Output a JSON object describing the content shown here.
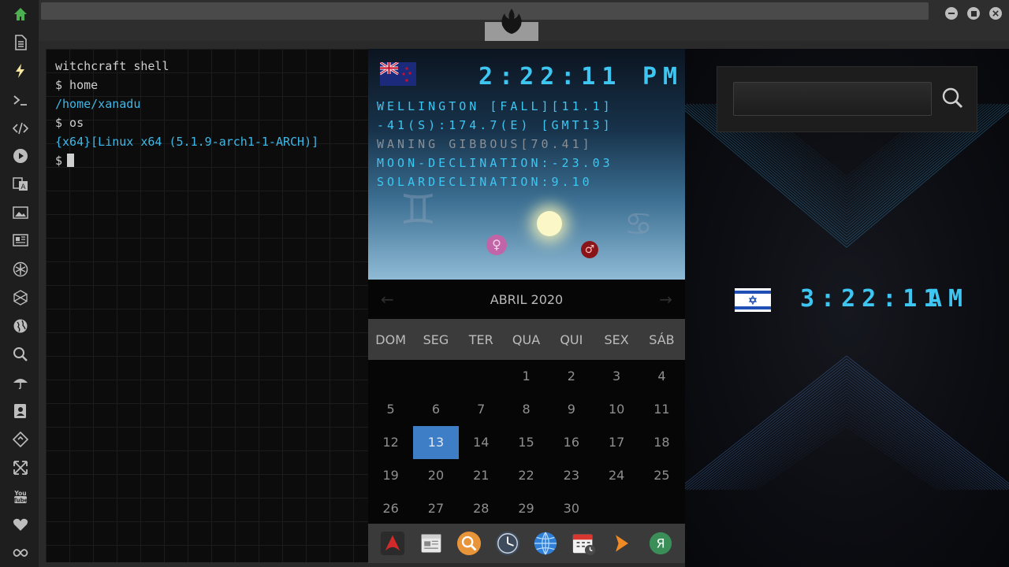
{
  "sidebar": {
    "items": [
      {
        "name": "home-icon",
        "color": "#4caf50"
      },
      {
        "name": "file-icon"
      },
      {
        "name": "bolt-icon",
        "color": "#f5e6a0"
      },
      {
        "name": "terminal-icon"
      },
      {
        "name": "code-icon"
      },
      {
        "name": "play-icon"
      },
      {
        "name": "translate-icon"
      },
      {
        "name": "image-icon"
      },
      {
        "name": "news-icon"
      },
      {
        "name": "rebel-icon"
      },
      {
        "name": "hexagon-icon"
      },
      {
        "name": "globe-icon"
      },
      {
        "name": "search-icon"
      },
      {
        "name": "umbrella-icon"
      },
      {
        "name": "contact-icon"
      },
      {
        "name": "git-icon"
      },
      {
        "name": "expand-icon"
      },
      {
        "name": "youtube-icon"
      },
      {
        "name": "heart-icon"
      },
      {
        "name": "infinity-icon"
      }
    ]
  },
  "terminal": {
    "lines": [
      {
        "text": "witchcraft shell",
        "style": "white"
      },
      {
        "text": "$ home",
        "style": "white"
      },
      {
        "text": "/home/xanadu",
        "style": "blue"
      },
      {
        "text": "$ os",
        "style": "white"
      },
      {
        "text": "{x64}[Linux x64 (5.1.9-arch1-1-ARCH)]",
        "style": "blue"
      }
    ],
    "prompt": "$"
  },
  "sky_clock": {
    "time": "2:22:11",
    "ampm": "PM",
    "lines": [
      {
        "text": "WELLINGTON [FALL][11.1]",
        "dim": false
      },
      {
        "text": "-41(S):174.7(E) [GMT13]",
        "dim": false
      },
      {
        "text": "WANING GIBBOUS[70.41]",
        "dim": true
      },
      {
        "text": "MOON-DECLINATION:-23.03",
        "dim": false
      },
      {
        "text": "SOLARDECLINATION:9.10",
        "dim": false
      }
    ],
    "venus_symbol": "♀",
    "mars_symbol": "♂",
    "gemini_symbol": "♊",
    "cancer_symbol": "♋"
  },
  "calendar": {
    "month_label": "ABRIL 2020",
    "prev": "←",
    "next": "→",
    "weekdays": [
      "DOM",
      "SEG",
      "TER",
      "QUA",
      "QUI",
      "SEX",
      "SÁB"
    ],
    "days": [
      "",
      "",
      "",
      "1",
      "2",
      "3",
      "4",
      "5",
      "6",
      "7",
      "8",
      "9",
      "10",
      "11",
      "12",
      "13",
      "14",
      "15",
      "16",
      "17",
      "18",
      "19",
      "20",
      "21",
      "22",
      "23",
      "24",
      "25",
      "26",
      "27",
      "28",
      "29",
      "30"
    ],
    "selected": "13",
    "selected_color": "#3d7ec6"
  },
  "dock": {
    "apps": [
      "arch-linux-icon",
      "calendar-news-icon",
      "magnifier-icon",
      "clock-icon",
      "globe-icon",
      "calendar-clock-icon",
      "forward-icon",
      "yandex-icon"
    ]
  },
  "search": {
    "value": "",
    "placeholder": ""
  },
  "israel_clock": {
    "time": "3:22:11",
    "ampm": "AM"
  },
  "colors": {
    "accent": "#3ec6f2",
    "terminal_blue": "#3fb8e8"
  }
}
